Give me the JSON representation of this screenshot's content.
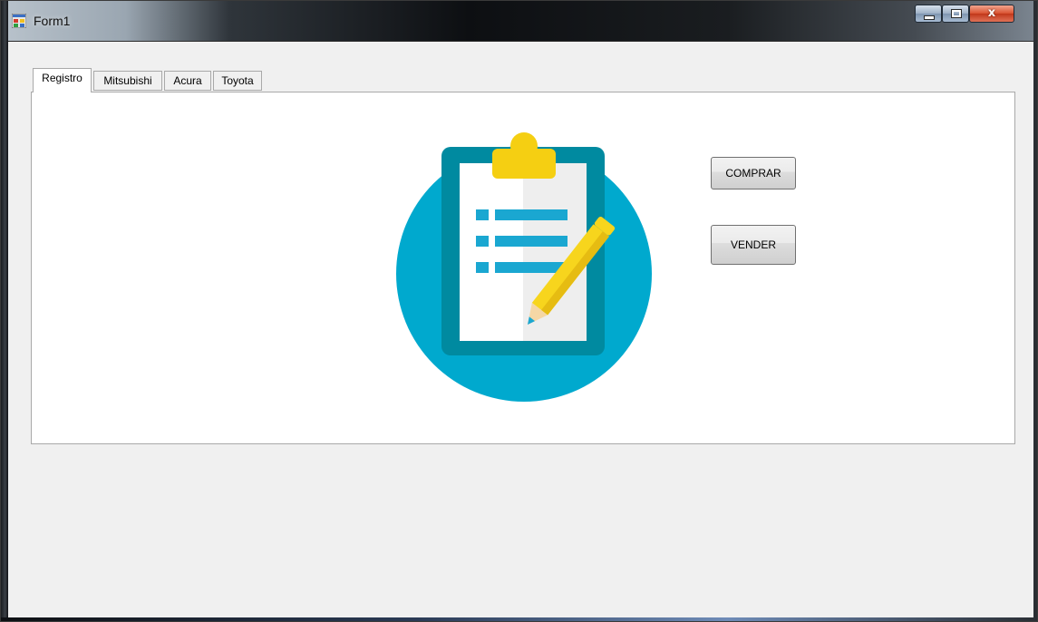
{
  "window": {
    "title": "Form1",
    "icon": "form-app-icon",
    "controls": {
      "minimize": "minimize-icon",
      "maximize": "maximize-icon",
      "close_label": "x"
    }
  },
  "tabs": [
    {
      "label": "Registro",
      "active": true
    },
    {
      "label": "Mitsubishi",
      "active": false
    },
    {
      "label": "Acura",
      "active": false
    },
    {
      "label": "Toyota",
      "active": false
    }
  ],
  "panel": {
    "illustration": "clipboard-pencil-icon",
    "buttons": {
      "comprar": "COMPRAR",
      "vender": "VENDER"
    }
  },
  "colors": {
    "circle": "#00a9ce",
    "clipboard_frame": "#008aa0",
    "paper": "#ffffff",
    "paper_shade": "#eeeeee",
    "clip": "#f5cf12",
    "list": "#1aa7d1",
    "pencil": "#f7d51d",
    "pencil_dark": "#e6bc12"
  }
}
